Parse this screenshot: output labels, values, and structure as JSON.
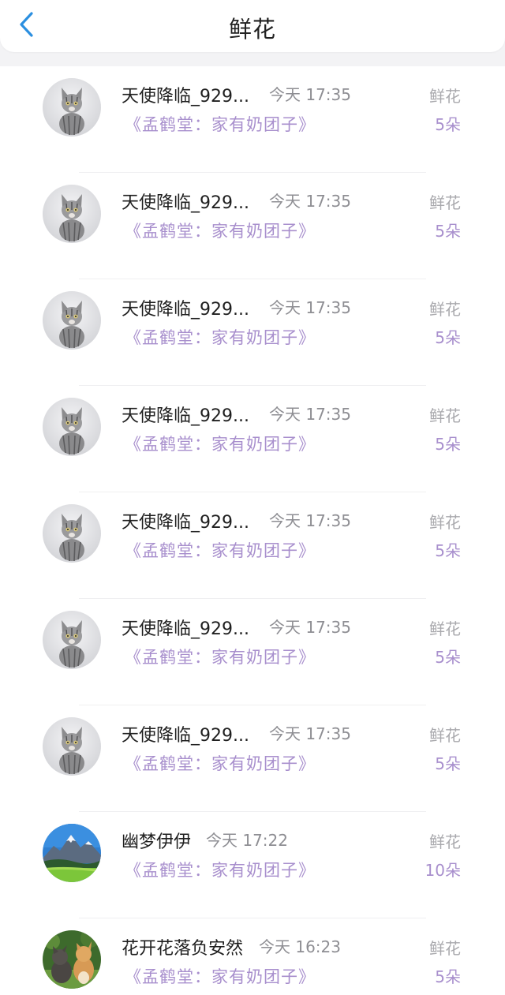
{
  "header": {
    "title": "鲜花"
  },
  "items": [
    {
      "name": "天使降临_929...",
      "time": "今天 17:35",
      "book": "《孟鹤堂：家有奶团子》",
      "gift_type": "鲜花",
      "gift_count": "5朵",
      "avatar": "kitten-avatar"
    },
    {
      "name": "天使降临_929...",
      "time": "今天 17:35",
      "book": "《孟鹤堂：家有奶团子》",
      "gift_type": "鲜花",
      "gift_count": "5朵",
      "avatar": "kitten-avatar"
    },
    {
      "name": "天使降临_929...",
      "time": "今天 17:35",
      "book": "《孟鹤堂：家有奶团子》",
      "gift_type": "鲜花",
      "gift_count": "5朵",
      "avatar": "kitten-avatar"
    },
    {
      "name": "天使降临_929...",
      "time": "今天 17:35",
      "book": "《孟鹤堂：家有奶团子》",
      "gift_type": "鲜花",
      "gift_count": "5朵",
      "avatar": "kitten-avatar"
    },
    {
      "name": "天使降临_929...",
      "time": "今天 17:35",
      "book": "《孟鹤堂：家有奶团子》",
      "gift_type": "鲜花",
      "gift_count": "5朵",
      "avatar": "kitten-avatar"
    },
    {
      "name": "天使降临_929...",
      "time": "今天 17:35",
      "book": "《孟鹤堂：家有奶团子》",
      "gift_type": "鲜花",
      "gift_count": "5朵",
      "avatar": "kitten-avatar"
    },
    {
      "name": "天使降临_929...",
      "time": "今天 17:35",
      "book": "《孟鹤堂：家有奶团子》",
      "gift_type": "鲜花",
      "gift_count": "5朵",
      "avatar": "kitten-avatar"
    },
    {
      "name": "幽梦伊伊",
      "time": "今天 17:22",
      "book": "《孟鹤堂：家有奶团子》",
      "gift_type": "鲜花",
      "gift_count": "10朵",
      "avatar": "mountain-avatar"
    },
    {
      "name": "花开花落负安然",
      "time": "今天 16:23",
      "book": "《孟鹤堂：家有奶团子》",
      "gift_type": "鲜花",
      "gift_count": "5朵",
      "avatar": "cats-avatar"
    }
  ],
  "colors": {
    "accent": "#a88fcd",
    "back_icon": "#2b8fe0",
    "muted_text": "#8e8e93"
  }
}
